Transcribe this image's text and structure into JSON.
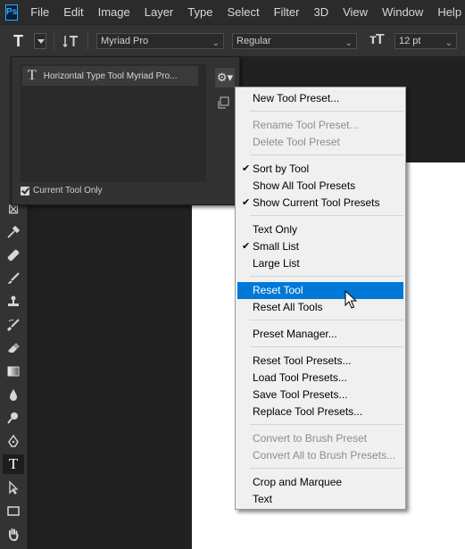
{
  "app": {
    "logo": "Ps"
  },
  "menubar": [
    "File",
    "Edit",
    "Image",
    "Layer",
    "Type",
    "Select",
    "Filter",
    "3D",
    "View",
    "Window",
    "Help"
  ],
  "options": {
    "tool_icon": "T",
    "font_family": "Myriad Pro",
    "font_style": "Regular",
    "font_size": "12 pt"
  },
  "preset_panel": {
    "item_icon": "T",
    "item_label": "Horizontal Type Tool Myriad Pro...",
    "current_tool_only": "Current Tool Only",
    "current_tool_only_checked": true
  },
  "context_menu": {
    "items": [
      {
        "label": "New Tool Preset...",
        "enabled": true,
        "checked": false
      },
      {
        "label": "Rename Tool Preset...",
        "enabled": false,
        "checked": false
      },
      {
        "label": "Delete Tool Preset",
        "enabled": false,
        "checked": false
      },
      {
        "label": "Sort by Tool",
        "enabled": true,
        "checked": true
      },
      {
        "label": "Show All Tool Presets",
        "enabled": true,
        "checked": false
      },
      {
        "label": "Show Current Tool Presets",
        "enabled": true,
        "checked": true
      },
      {
        "label": "Text Only",
        "enabled": true,
        "checked": false
      },
      {
        "label": "Small List",
        "enabled": true,
        "checked": true
      },
      {
        "label": "Large List",
        "enabled": true,
        "checked": false
      },
      {
        "label": "Reset Tool",
        "enabled": true,
        "checked": false,
        "highlighted": true
      },
      {
        "label": "Reset All Tools",
        "enabled": true,
        "checked": false
      },
      {
        "label": "Preset Manager...",
        "enabled": true,
        "checked": false
      },
      {
        "label": "Reset Tool Presets...",
        "enabled": true,
        "checked": false
      },
      {
        "label": "Load Tool Presets...",
        "enabled": true,
        "checked": false
      },
      {
        "label": "Save Tool Presets...",
        "enabled": true,
        "checked": false
      },
      {
        "label": "Replace Tool Presets...",
        "enabled": true,
        "checked": false
      },
      {
        "label": "Convert to Brush Preset",
        "enabled": false,
        "checked": false
      },
      {
        "label": "Convert All to Brush Presets...",
        "enabled": false,
        "checked": false
      },
      {
        "label": "Crop and Marquee",
        "enabled": true,
        "checked": false
      },
      {
        "label": "Text",
        "enabled": true,
        "checked": false
      }
    ],
    "check_glyph": "✔"
  },
  "colors": {
    "highlight": "#0078d7",
    "menu_bg": "#f0f0f0",
    "panel_bg": "#323232"
  }
}
